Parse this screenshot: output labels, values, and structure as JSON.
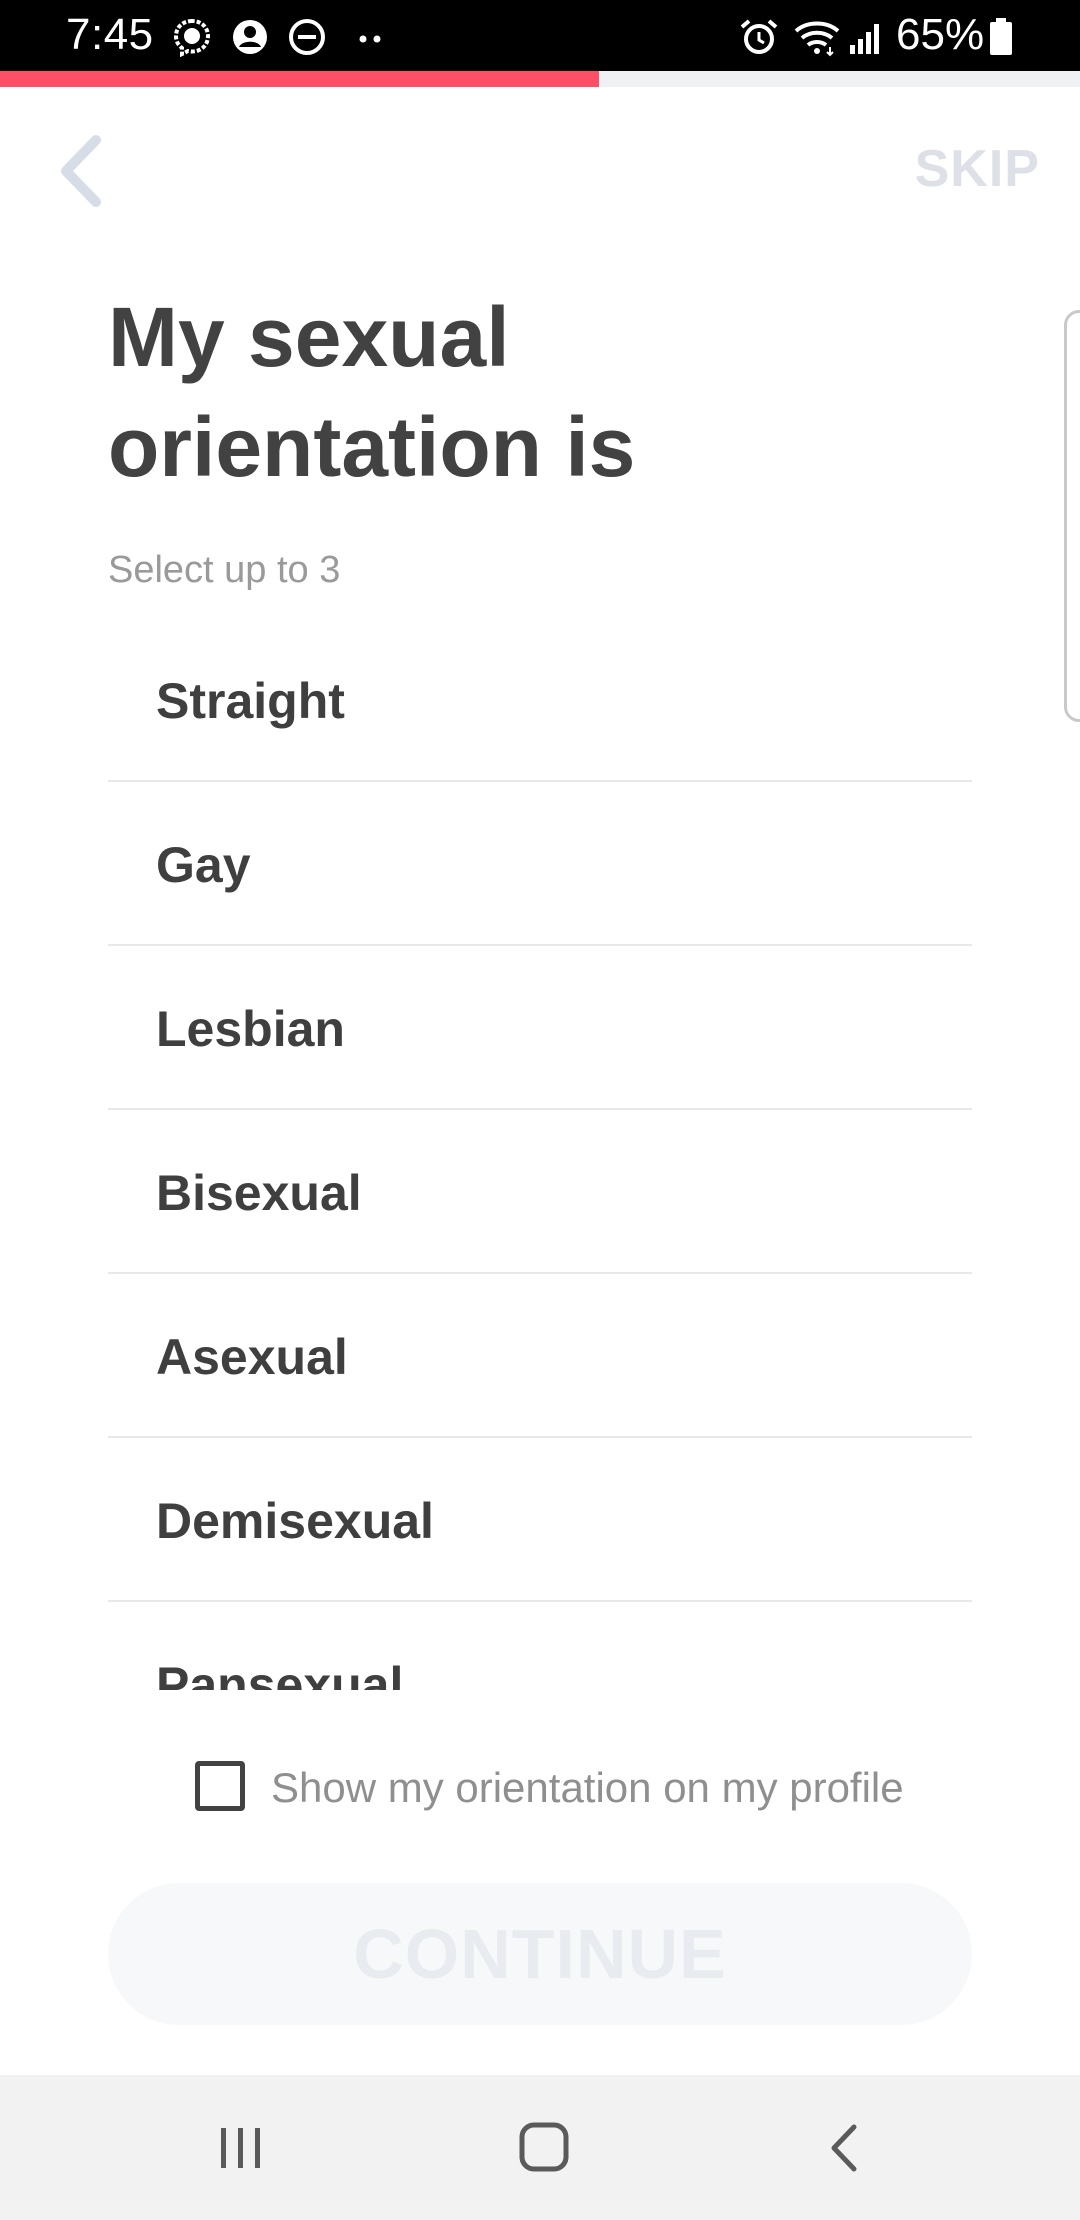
{
  "status_bar": {
    "time": "7:45",
    "battery_percent": "65%",
    "left_icons": [
      "messenger-icon",
      "account-circle-icon",
      "do-not-disturb-icon",
      "more-dots-icon"
    ],
    "right_icons": [
      "alarm-icon",
      "wifi-icon",
      "signal-icon",
      "battery-icon"
    ]
  },
  "progress": {
    "value_percent": 55.5,
    "fill_color": "#fd5068"
  },
  "nav": {
    "back_icon": "chevron-left-icon",
    "skip_label": "SKIP"
  },
  "header": {
    "title_line1": "My sexual",
    "title_line2": "orientation is",
    "subtitle": "Select up to 3"
  },
  "options": [
    {
      "label": "Straight"
    },
    {
      "label": "Gay"
    },
    {
      "label": "Lesbian"
    },
    {
      "label": "Bisexual"
    },
    {
      "label": "Asexual"
    },
    {
      "label": "Demisexual"
    },
    {
      "label": "Pansexual"
    }
  ],
  "show_orientation": {
    "label": "Show my orientation on my profile",
    "checked": false
  },
  "continue_button": {
    "label": "CONTINUE",
    "enabled": false
  },
  "system_nav": {
    "recents_icon": "recents-icon",
    "home_icon": "home-icon",
    "back_icon": "back-icon"
  },
  "colors": {
    "accent": "#fd5068",
    "title_text": "#424242",
    "muted_text": "#9a9a9a",
    "disabled": "#dde1e7"
  }
}
